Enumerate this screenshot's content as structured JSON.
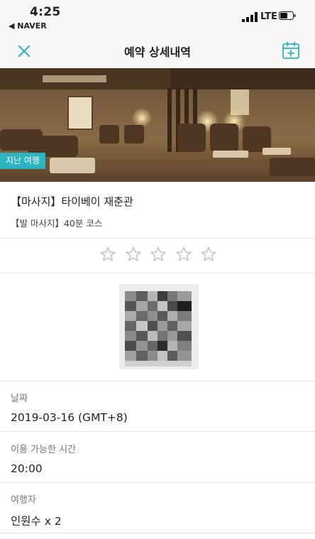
{
  "status": {
    "time": "4:25",
    "back_app": "◀ NAVER",
    "network": "LTE"
  },
  "nav": {
    "title": "예약 상세내역",
    "close_icon": "close-icon",
    "calendar_icon": "calendar-add-icon"
  },
  "accent_color": "#2bb5c2",
  "badge": "지난 여행",
  "product": {
    "title": "【마사지】타이베이 재춘관",
    "option": "【발 마사지】40분 코스"
  },
  "rating": {
    "stars_total": 5,
    "stars_filled": 0
  },
  "details": [
    {
      "label": "날짜",
      "value": "2019-03-16 (GMT+8)"
    },
    {
      "label": "이용 가능한 시간",
      "value": "20:00"
    },
    {
      "label": "여행자",
      "value": "인원수 x 2"
    }
  ]
}
